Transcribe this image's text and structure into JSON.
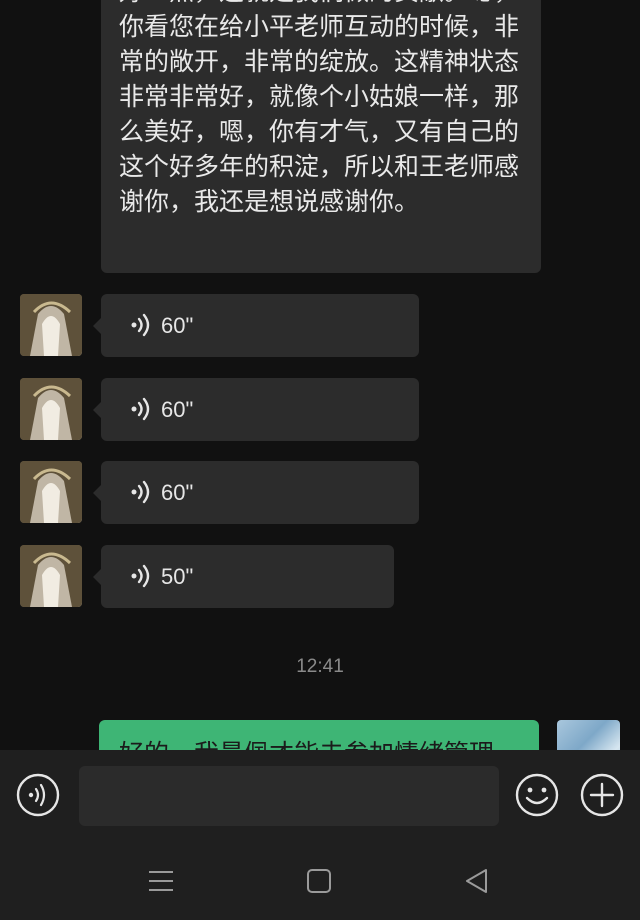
{
  "messages": {
    "text_bubble": "好一点，这就是我们做的贡献。嗯，你看您在给小平老师互动的时候，非常的敞开，非常的绽放。这精神状态非常非常好，就像个小姑娘一样，那么美好，嗯，你有才气，又有自己的这个好多年的积淀，所以和王老师感谢你，我还是想说感谢你。",
    "voice_messages": [
      {
        "duration": "60\""
      },
      {
        "duration": "60\""
      },
      {
        "duration": "60\""
      },
      {
        "duration": "50\""
      }
    ],
    "timestamp": "12:41",
    "outgoing_text": "好的，我最佩才能去参加情绪管理"
  },
  "input": {
    "placeholder": "",
    "value": ""
  },
  "icons": {
    "voice_toggle": "voice-input-icon",
    "emoji": "emoji-icon",
    "more": "plus-icon",
    "nav_menu": "menu-icon",
    "nav_home": "home-icon",
    "nav_back": "back-icon"
  },
  "colors": {
    "background": "#111111",
    "incoming_bubble": "#2c2c2c",
    "outgoing_bubble": "#3eb575"
  }
}
